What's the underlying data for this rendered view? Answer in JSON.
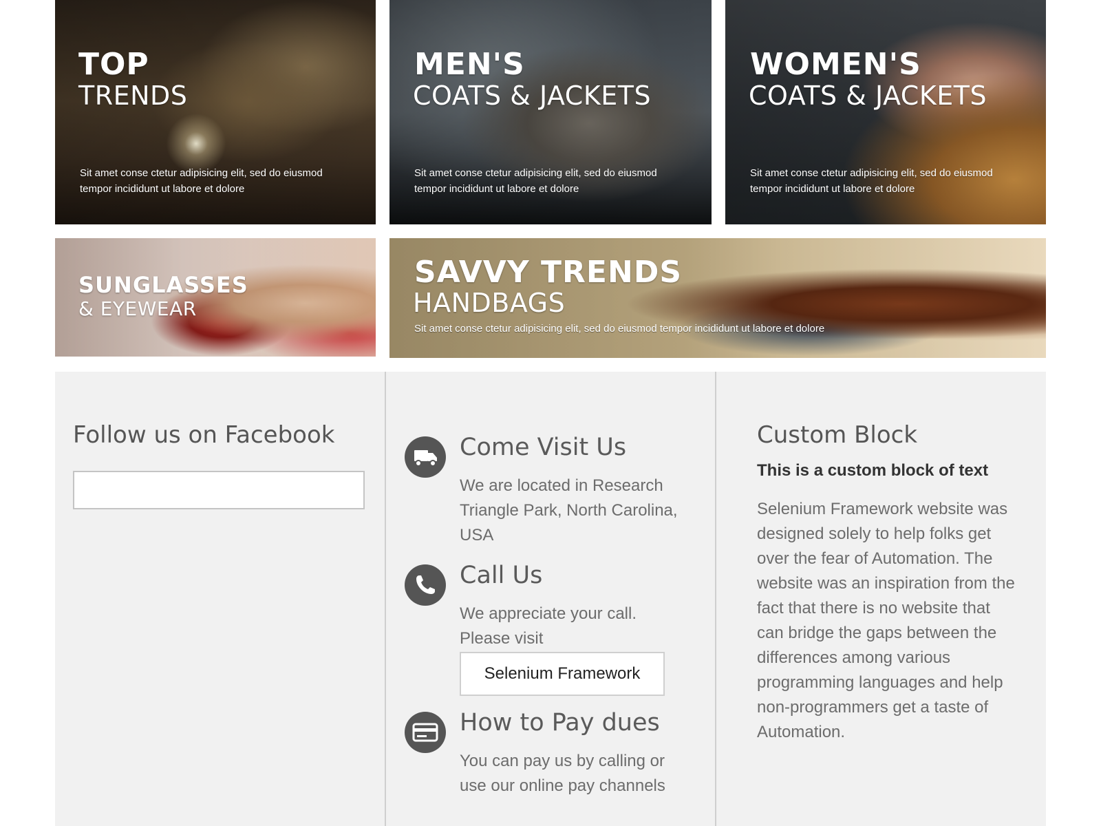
{
  "banners": {
    "top_trends": {
      "line1": "TOP",
      "line2": "TRENDS",
      "desc1": "Sit amet conse ctetur adipisicing elit, sed do eiusmod",
      "desc2": "tempor incididunt ut labore et dolore"
    },
    "mens": {
      "line1": "MEN'S",
      "line2": "COATS & JACKETS",
      "desc1": "Sit amet conse ctetur adipisicing elit, sed do eiusmod",
      "desc2": "tempor incididunt ut labore et dolore"
    },
    "womens": {
      "line1": "WOMEN'S",
      "line2": "COATS & JACKETS",
      "desc1": "Sit amet conse ctetur adipisicing elit, sed do eiusmod",
      "desc2": "tempor incididunt ut labore et dolore"
    },
    "sunglasses": {
      "line1": "SUNGLASSES",
      "line2": "& EYEWEAR"
    },
    "handbags": {
      "line1": "SAVVY TRENDS",
      "line2": "HANDBAGS",
      "desc": "Sit amet conse ctetur adipisicing elit, sed do eiusmod tempor incididunt ut labore et dolore"
    }
  },
  "footer": {
    "facebook": {
      "title": "Follow us on Facebook"
    },
    "contact": {
      "visit_title": "Come Visit Us",
      "visit_text": "We are located in Research Triangle Park, North Carolina, USA",
      "visit_icon": "truck-icon",
      "call_title": "Call Us",
      "call_text": "We appreciate your call. Please visit",
      "call_icon": "phone-icon",
      "call_button": "Selenium Framework",
      "pay_title": "How to Pay dues",
      "pay_text": "You can pay us by calling or use our online pay channels",
      "pay_icon": "credit-card-icon"
    },
    "custom": {
      "title": "Custom Block",
      "bold": "This is a custom block of text",
      "text": "Selenium Framework website was designed solely to help folks get over the fear of Automation. The website was an inspiration from the fact that there is no website that can bridge the gaps between the differences among various programming languages and help non-programmers get a taste of Automation."
    },
    "colors": {
      "background": "#f1f1f1",
      "icon": "#555555",
      "text": "#6c6c6c"
    }
  }
}
